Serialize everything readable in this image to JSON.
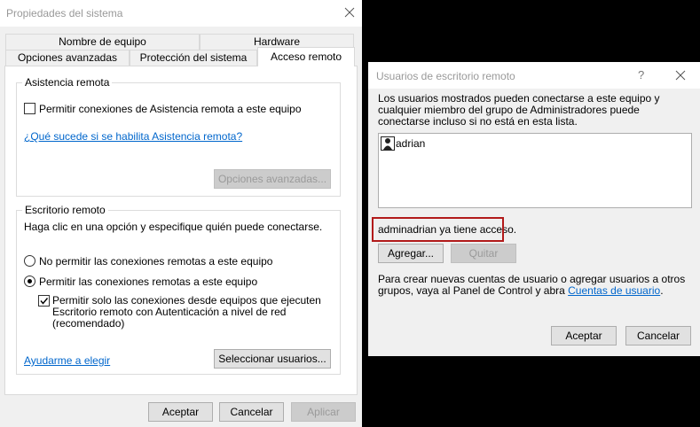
{
  "system_dialog": {
    "title": "Propiedades del sistema",
    "tabs_row1": [
      "Nombre de equipo",
      "Hardware"
    ],
    "tabs_row2": [
      "Opciones avanzadas",
      "Protección del sistema",
      "Acceso remoto"
    ],
    "selected_tab": "Acceso remoto",
    "remote_assistance": {
      "group_title": "Asistencia remota",
      "checkbox_label": "Permitir conexiones de Asistencia remota a este equipo",
      "checkbox_checked": false,
      "link": "¿Qué sucede si se habilita Asistencia remota?",
      "advanced_button": "Opciones avanzadas..."
    },
    "remote_desktop": {
      "group_title": "Escritorio remoto",
      "instruction": "Haga clic en una opción y especifique quién puede conectarse.",
      "radio_no": "No permitir las conexiones remotas a este equipo",
      "radio_yes": "Permitir las conexiones remotas a este equipo",
      "selected": "radio_yes",
      "nla_line1": "Permitir solo las conexiones desde equipos que ejecuten",
      "nla_line2": "Escritorio remoto con Autenticación a nivel de red",
      "nla_line3": "(recomendado)",
      "nla_checked": true,
      "help_link": "Ayudarme a elegir",
      "select_users_button": "Seleccionar usuarios..."
    },
    "buttons": {
      "ok": "Aceptar",
      "cancel": "Cancelar",
      "apply": "Aplicar"
    }
  },
  "rdu_dialog": {
    "title": "Usuarios de escritorio remoto",
    "help_glyph": "?",
    "description": "Los usuarios mostrados pueden conectarse a este equipo y cualquier miembro del grupo de Administradores puede conectarse incluso si no está en esta lista.",
    "users": [
      "adrian"
    ],
    "access_note": "adminadrian ya tiene acceso.",
    "add_button": "Agregar...",
    "remove_button": "Quitar",
    "footer_text": "Para crear nuevas cuentas de usuario o agregar usuarios a otros grupos, vaya al Panel de Control y abra ",
    "footer_link": "Cuentas de usuario",
    "footer_end": ".",
    "ok": "Aceptar",
    "cancel": "Cancelar"
  },
  "colors": {
    "link": "#0066cc",
    "highlight": "#b21a1a"
  }
}
